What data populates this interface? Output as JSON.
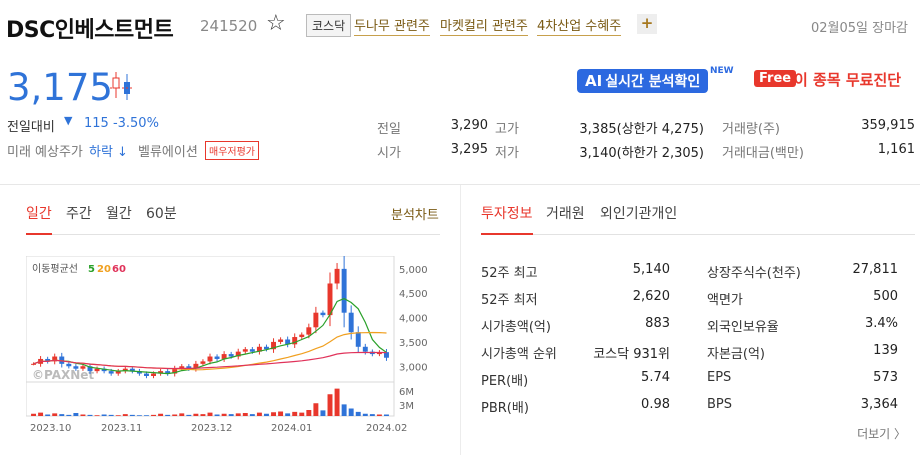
{
  "header": {
    "name": "DSC인베스트먼트",
    "code": "241520",
    "market": "코스닥",
    "themes": [
      "두나무 관련주",
      "마켓컬리 관련주",
      "4차산업 수혜주"
    ],
    "plus": "+",
    "date": "02월05일 장마감"
  },
  "price": {
    "current": "3,175",
    "change_label": "전일대비",
    "change_arrow": "▼",
    "change": "115 -3.50%",
    "forecast_label": "미래 예상주가",
    "forecast_value": "하락 ↓",
    "valuation_label": "벨류에이션",
    "valuation_btn": "매우저평가"
  },
  "promo": {
    "ai_prefix": "AI",
    "ai_text": "실시간 분석확인",
    "new": "NEW",
    "free": "Free",
    "free_text": "이 종목 무료진단"
  },
  "quote": {
    "prev_label": "전일",
    "prev": "3,290",
    "open_label": "시가",
    "open": "3,295",
    "high_label": "고가",
    "high": "3,385(상한가 4,275)",
    "low_label": "저가",
    "low": "3,140(하한가 2,305)",
    "volume_label": "거래량(주)",
    "volume": "359,915",
    "amount_label": "거래대금(백만)",
    "amount": "1,161"
  },
  "chart_tabs": [
    "일간",
    "주간",
    "월간",
    "60분"
  ],
  "chart_tab_right": "분석차트",
  "info_tabs": [
    "투자정보",
    "거래원",
    "외인기관개인"
  ],
  "chart": {
    "ma_label": "이동평균선",
    "ma_5": "5",
    "ma_20": "20",
    "ma_60": "60",
    "watermark": "©PAXNet",
    "price_ticks": [
      "5,000",
      "4,500",
      "4,000",
      "3,500",
      "3,000"
    ],
    "volume_ticks": [
      "6M",
      "3M"
    ],
    "date_ticks": [
      "2023.10",
      "2023.11",
      "2023.12",
      "2024.01",
      "2024.02"
    ],
    "colors": {
      "up": "#e8372c",
      "down": "#2f73d8",
      "ma5": "#2aa12a",
      "ma20": "#f0a020",
      "ma60": "#e0325a"
    }
  },
  "chart_data": {
    "type": "candlestick",
    "price_axis": [
      2800,
      5100
    ],
    "price_ticks": [
      3000,
      3500,
      4000,
      4500,
      5000
    ],
    "date_ticks": [
      "2023.10",
      "2023.11",
      "2023.12",
      "2024.01",
      "2024.02"
    ],
    "closes": [
      3050,
      3150,
      3100,
      3200,
      3050,
      3000,
      2950,
      3000,
      2900,
      2950,
      2900,
      2850,
      2900,
      2950,
      2900,
      2850,
      2800,
      2850,
      2900,
      2850,
      2950,
      3000,
      2950,
      3050,
      3100,
      3200,
      3150,
      3250,
      3200,
      3300,
      3350,
      3300,
      3400,
      3350,
      3500,
      3550,
      3450,
      3600,
      3650,
      3800,
      4100,
      4050,
      4700,
      5000,
      4100,
      3700,
      3400,
      3300,
      3250,
      3290,
      3175
    ],
    "volume_m": [
      0.6,
      0.9,
      0.4,
      0.7,
      0.5,
      0.3,
      0.8,
      0.4,
      0.3,
      0.2,
      0.4,
      0.3,
      0.2,
      0.5,
      0.3,
      0.2,
      0.2,
      0.3,
      0.6,
      0.3,
      0.4,
      0.7,
      0.3,
      0.6,
      0.5,
      0.9,
      0.4,
      0.6,
      0.5,
      0.7,
      0.8,
      0.5,
      0.9,
      0.6,
      1.0,
      1.2,
      0.7,
      1.1,
      0.9,
      1.6,
      3.4,
      1.5,
      5.8,
      7.3,
      3.1,
      2.0,
      1.1,
      0.6,
      0.5,
      0.4,
      0.4
    ]
  },
  "invest": {
    "left": [
      {
        "label": "52주 최고",
        "value": "5,140"
      },
      {
        "label": "52주 최저",
        "value": "2,620"
      },
      {
        "label": "시가총액(억)",
        "value": "883"
      },
      {
        "label": "시가총액 순위",
        "value": "코스닥 931위"
      },
      {
        "label": "PER(배)",
        "value": "5.74"
      },
      {
        "label": "PBR(배)",
        "value": "0.98"
      }
    ],
    "right": [
      {
        "label": "상장주식수(천주)",
        "value": "27,811"
      },
      {
        "label": "액면가",
        "value": "500"
      },
      {
        "label": "외국인보유율",
        "value": "3.4%"
      },
      {
        "label": "자본금(억)",
        "value": "139"
      },
      {
        "label": "EPS",
        "value": "573"
      },
      {
        "label": "BPS",
        "value": "3,364"
      }
    ],
    "more": "더보기 〉"
  }
}
